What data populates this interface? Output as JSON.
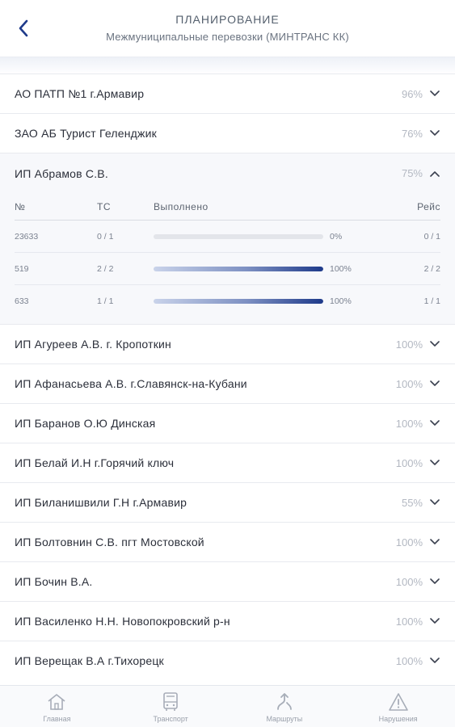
{
  "header": {
    "title": "ПЛАНИРОВАНИЕ",
    "subtitle": "Межмуниципальные перевозки (МИНТРАНС КК)"
  },
  "carriers_before": [
    {
      "name": "АО ПАТП №1 г.Армавир",
      "percent": "96%"
    },
    {
      "name": "ЗАО АБ Турист Геленджик",
      "percent": "76%"
    }
  ],
  "expanded": {
    "name": "ИП Абрамов С.В.",
    "percent": "75%",
    "columns": {
      "num": "№",
      "ts": "ТС",
      "done": "Выполнено",
      "reys": "Рейс"
    },
    "routes": [
      {
        "num": "23633",
        "ts": "0 / 1",
        "done_fraction": 0.0,
        "done_label": "0%",
        "reys": "0 / 1"
      },
      {
        "num": "519",
        "ts": "2 / 2",
        "done_fraction": 1.0,
        "done_label": "100%",
        "reys": "2 / 2"
      },
      {
        "num": "633",
        "ts": "1 / 1",
        "done_fraction": 1.0,
        "done_label": "100%",
        "reys": "1 / 1"
      }
    ]
  },
  "carriers_after": [
    {
      "name": "ИП Агуреев А.В. г. Кропоткин",
      "percent": "100%"
    },
    {
      "name": "ИП Афанасьева А.В. г.Славянск-на-Кубани",
      "percent": "100%"
    },
    {
      "name": "ИП Баранов О.Ю Динская",
      "percent": "100%"
    },
    {
      "name": "ИП Белай И.Н г.Горячий ключ",
      "percent": "100%"
    },
    {
      "name": "ИП Биланишвили Г.Н г.Армавир",
      "percent": "55%"
    },
    {
      "name": "ИП Болтовнин С.В. пгт Мостовской",
      "percent": "100%"
    },
    {
      "name": "ИП Бочин В.А.",
      "percent": "100%"
    },
    {
      "name": "ИП Василенко Н.Н. Новопокровский р-н",
      "percent": "100%"
    },
    {
      "name": "ИП Верещак В.А г.Тихорецк",
      "percent": "100%"
    }
  ],
  "tabbar": {
    "tabs": [
      {
        "label": "Главная",
        "icon": "home-icon"
      },
      {
        "label": "Транспорт",
        "icon": "bus-icon"
      },
      {
        "label": "Маршруты",
        "icon": "route-icon"
      },
      {
        "label": "Нарушения",
        "icon": "warning-icon"
      }
    ]
  },
  "colors": {
    "accent": "#1e3a8a",
    "text": "#2b2f3a",
    "muted": "#b3b8c2"
  }
}
